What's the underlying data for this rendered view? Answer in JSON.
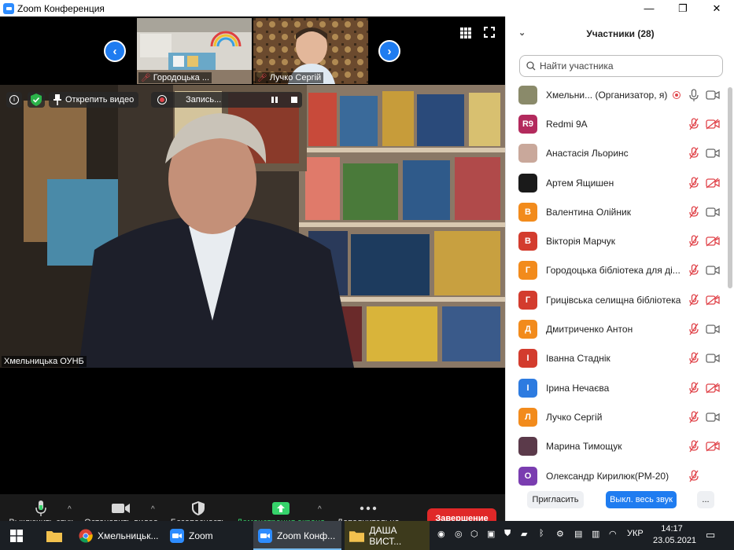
{
  "window": {
    "title": "Zoom Конференция",
    "minimize": "—",
    "maximize": "❐",
    "close": "✕"
  },
  "thumbnails": [
    {
      "name": "Городоцька ..."
    },
    {
      "name": "Лучко Сергій"
    }
  ],
  "main_video": {
    "unpin_label": "Открепить видео",
    "recording_label": "Запись...",
    "speaker": "Хмельницька ОУНБ"
  },
  "toolbar": {
    "mute_label": "Выключить звук",
    "stop_video_label": "Остановить видео",
    "security_label": "Безопасность",
    "share_label": "Демонстрация экрана",
    "more_label": "Дополнительно",
    "end_label": "Завершение"
  },
  "participants": {
    "header": "Участники (28)",
    "search_placeholder": "Найти участника",
    "items": [
      {
        "name": "Хмельни...  (Организатор, я)",
        "avatar": "",
        "avatar_color": "#8a8a6a",
        "mic_muted": false,
        "cam_off": false,
        "is_host": true
      },
      {
        "name": "Redmi 9A",
        "avatar": "R9",
        "avatar_color": "#b32a5d",
        "mic_muted": true,
        "cam_off": true
      },
      {
        "name": "Анастасія Льоринс",
        "avatar": "",
        "avatar_color": "#c9a89b",
        "mic_muted": true,
        "cam_off": false
      },
      {
        "name": "Артем Ящишен",
        "avatar": "",
        "avatar_color": "#1a1a1a",
        "mic_muted": true,
        "cam_off": true
      },
      {
        "name": "Валентина Олійник",
        "avatar": "В",
        "avatar_color": "#f28b1c",
        "mic_muted": true,
        "cam_off": false
      },
      {
        "name": "Вікторія Марчук",
        "avatar": "В",
        "avatar_color": "#d33c2e",
        "mic_muted": true,
        "cam_off": true
      },
      {
        "name": "Городоцька бібліотека для ді...",
        "avatar": "Г",
        "avatar_color": "#f28b1c",
        "mic_muted": true,
        "cam_off": false
      },
      {
        "name": "Грицівська селищна бібліотека",
        "avatar": "Г",
        "avatar_color": "#d33c2e",
        "mic_muted": true,
        "cam_off": true
      },
      {
        "name": "Дмитриченко Антон",
        "avatar": "Д",
        "avatar_color": "#f28b1c",
        "mic_muted": true,
        "cam_off": false
      },
      {
        "name": "Іванна Стаднік",
        "avatar": "І",
        "avatar_color": "#d33c2e",
        "mic_muted": true,
        "cam_off": false
      },
      {
        "name": "Ірина Нечаєва",
        "avatar": "І",
        "avatar_color": "#2d7be0",
        "mic_muted": true,
        "cam_off": true
      },
      {
        "name": "Лучко Сергій",
        "avatar": "Л",
        "avatar_color": "#f28b1c",
        "mic_muted": true,
        "cam_off": false
      },
      {
        "name": "Марина Тимощук",
        "avatar": "",
        "avatar_color": "#5b3a4a",
        "mic_muted": true,
        "cam_off": true
      },
      {
        "name": "Олександр Кирилюк(РМ-20)",
        "avatar": "О",
        "avatar_color": "#7a3db0",
        "mic_muted": true,
        "cam_off": null
      }
    ],
    "invite_label": "Пригласить",
    "mute_all_label": "Выкл. весь звук",
    "more_label": "..."
  },
  "taskbar": {
    "items": [
      {
        "label": "Хмельницьк...",
        "icon": "chrome-icon"
      },
      {
        "label": "Zoom",
        "icon": "zoom-icon"
      },
      {
        "label": "Zoom Конф...",
        "icon": "zoom-icon",
        "active": true
      },
      {
        "label": "ДАША ВИСТ...",
        "icon": "folder-icon"
      }
    ],
    "lang": "УКР",
    "time": "14:17",
    "date": "23.05.2021"
  }
}
